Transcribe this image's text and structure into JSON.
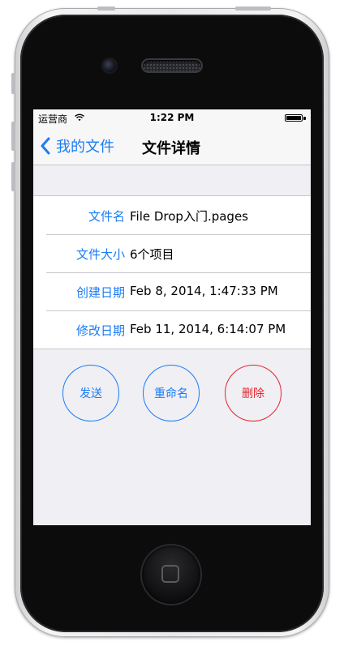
{
  "statusbar": {
    "carrier": "运营商",
    "time": "1:22 PM"
  },
  "navbar": {
    "back_label": "我的文件",
    "title": "文件详情"
  },
  "details": [
    {
      "label": "文件名",
      "value": "File Drop入门.pages"
    },
    {
      "label": "文件大小",
      "value": "6个项目"
    },
    {
      "label": "创建日期",
      "value": "Feb 8, 2014, 1:47:33 PM"
    },
    {
      "label": "修改日期",
      "value": "Feb 11, 2014, 6:14:07 PM"
    }
  ],
  "actions": {
    "send": "发送",
    "rename": "重命名",
    "delete": "删除"
  },
  "colors": {
    "accent": "#1a7cf5",
    "destructive": "#e8242c",
    "background": "#efeff4"
  },
  "icons": [
    "wifi-icon",
    "battery-icon",
    "back-chevron-icon",
    "home-button-icon"
  ]
}
